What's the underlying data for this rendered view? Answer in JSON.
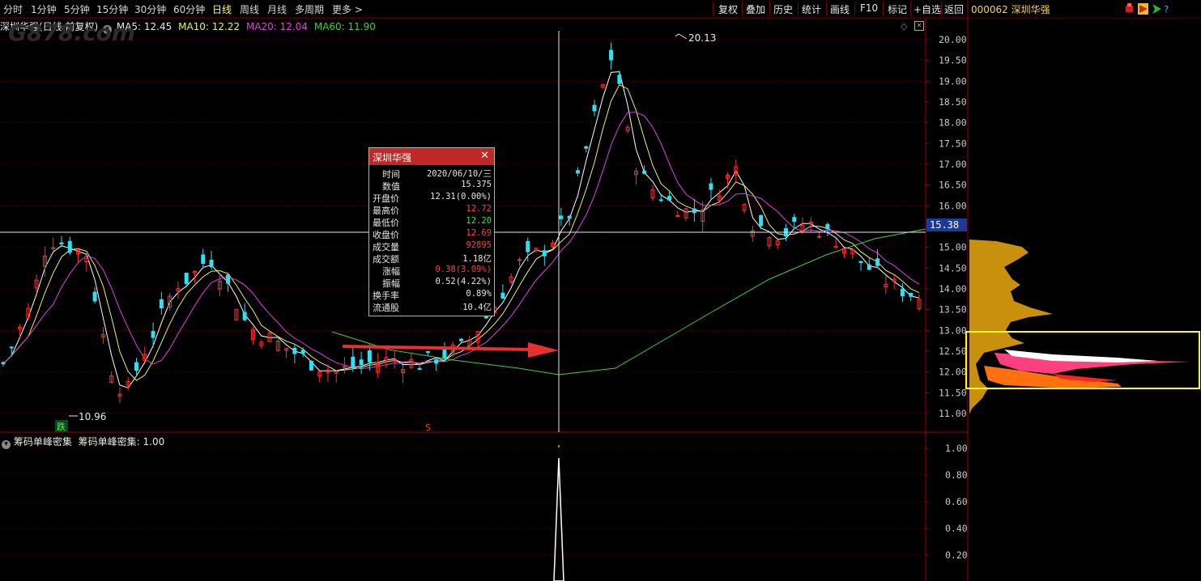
{
  "toolbar": {
    "periods": [
      "分时",
      "1分钟",
      "5分钟",
      "15分钟",
      "30分钟",
      "60分钟",
      "日线",
      "周线",
      "月线",
      "多周期",
      "更多 >"
    ],
    "active_period": "日线",
    "actions": [
      "复权",
      "叠加",
      "历史",
      "统计",
      "画线",
      "F10",
      "标记",
      "+自选",
      "返回"
    ]
  },
  "header": {
    "stock_title": "深圳华强(日线,前复权)",
    "ma5": "MA5: 12.45",
    "ma10": "MA10: 12.22",
    "ma20": "MA20: 12.04",
    "ma60": "MA60: 11.90"
  },
  "indicator": {
    "title": "筹码单峰密集",
    "label": "筹码单峰密集: 1.00"
  },
  "watermark": "G878.com",
  "annotations": {
    "high": "20.13",
    "low": "10.96",
    "low_badge": "跌",
    "s_marker": "S",
    "crosshair_price": "15.38"
  },
  "popup": {
    "title": "深圳华强",
    "close": "✕",
    "rows": [
      {
        "k": "时间",
        "v": "2020/06/10/三",
        "indent": true,
        "color": "#e6e6e6"
      },
      {
        "k": "数值",
        "v": "15.375",
        "indent": true,
        "color": "#e6e6e6"
      },
      {
        "k": "开盘价",
        "v": "12.31(0.00%)",
        "indent": false,
        "color": "#e6e6e6"
      },
      {
        "k": "最高价",
        "v": "12.72",
        "indent": false,
        "color": "#ff4040"
      },
      {
        "k": "最低价",
        "v": "12.20",
        "indent": false,
        "color": "#40e040"
      },
      {
        "k": "收盘价",
        "v": "12.69",
        "indent": false,
        "color": "#ff4040"
      },
      {
        "k": "成交量",
        "v": "92895",
        "indent": false,
        "color": "#ff4040"
      },
      {
        "k": "成交额",
        "v": "1.18亿",
        "indent": false,
        "color": "#e6e6e6"
      },
      {
        "k": "涨幅",
        "v": "0.38(3.09%)",
        "indent": true,
        "color": "#ff4040"
      },
      {
        "k": "振幅",
        "v": "0.52(4.22%)",
        "indent": true,
        "color": "#e6e6e6"
      },
      {
        "k": "换手率",
        "v": "0.89%",
        "indent": false,
        "color": "#e6e6e6"
      },
      {
        "k": "流通股",
        "v": "10.4亿",
        "indent": false,
        "color": "#e6e6e6"
      }
    ]
  },
  "right_panel": {
    "code_name": "000062 深圳华强"
  },
  "price_axis": [
    "20.00",
    "19.50",
    "19.00",
    "18.50",
    "18.00",
    "17.50",
    "17.00",
    "16.50",
    "16.00",
    "15.50",
    "15.00",
    "14.50",
    "14.00",
    "13.50",
    "13.00",
    "12.50",
    "12.00",
    "11.50",
    "11.00"
  ],
  "indicator_axis": [
    "1.00",
    "0.80",
    "0.60",
    "0.40",
    "0.20"
  ],
  "colors": {
    "up": "#ff3030",
    "down": "#30e0f0",
    "ma5": "#ffffff",
    "ma10": "#f0f060",
    "ma20": "#e040e0",
    "ma60": "#40d040",
    "grid": "#5a0000",
    "chip_gold": "#c8900c",
    "chip_pink": "#ff4080",
    "chip_orange": "#ff7010",
    "highlight_box": "#ffff00"
  }
}
